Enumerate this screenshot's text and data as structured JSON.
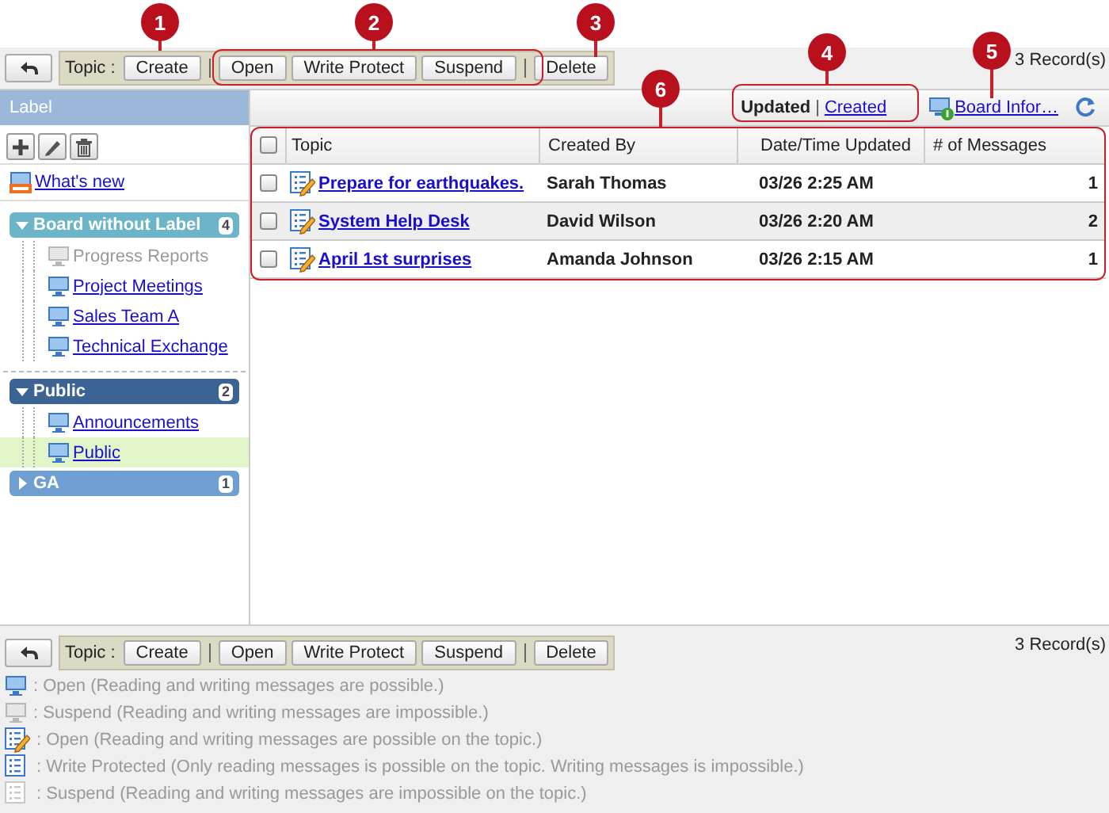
{
  "top_toolbar": {
    "topic_label": "Topic :",
    "button_groups": [
      [
        "Create"
      ],
      [
        "Open",
        "Write Protect",
        "Suspend"
      ],
      [
        "Delete"
      ]
    ],
    "record_count": "3 Record(s)"
  },
  "sidebar": {
    "title": "Label",
    "whats_new": "What's new",
    "labels": [
      {
        "name": "Board without Label",
        "count": "4",
        "expanded": true,
        "color": "#6cb4c8",
        "boards": [
          {
            "name": "Progress Reports",
            "suspended": true,
            "selected": false
          },
          {
            "name": "Project Meetings",
            "suspended": false,
            "selected": false
          },
          {
            "name": "Sales Team A",
            "suspended": false,
            "selected": false
          },
          {
            "name": "Technical Exchange",
            "suspended": false,
            "selected": false
          }
        ]
      },
      {
        "name": "Public",
        "count": "2",
        "expanded": true,
        "color": "#3b6494",
        "boards": [
          {
            "name": "Announcements",
            "suspended": false,
            "selected": false
          },
          {
            "name": "Public",
            "suspended": false,
            "selected": true
          }
        ]
      },
      {
        "name": "GA",
        "count": "1",
        "expanded": false,
        "color": "#6f9ed2"
      }
    ]
  },
  "sort": [
    {
      "label": "Updated",
      "selected": true
    },
    {
      "label": "Created",
      "selected": false
    }
  ],
  "sort_separator": "|",
  "board_info_link": "Board Infor…",
  "table": {
    "all_checked": false,
    "columns": [
      "Topic",
      "Created By",
      "Date/Time Updated",
      "# of Messages"
    ],
    "rows": [
      {
        "checked": false,
        "topic": "Prepare for earthquakes.",
        "created_by": "Sarah Thomas",
        "updated": "03/26 2:25 AM",
        "messages": "1"
      },
      {
        "checked": false,
        "topic": "System Help Desk",
        "created_by": "David Wilson",
        "updated": "03/26 2:20 AM",
        "messages": "2"
      },
      {
        "checked": false,
        "topic": "April 1st surprises",
        "created_by": "Amanda Johnson",
        "updated": "03/26 2:15 AM",
        "messages": "1"
      }
    ]
  },
  "bottom_toolbar": {
    "topic_label": "Topic :",
    "button_groups": [
      [
        "Create"
      ],
      [
        "Open",
        "Write Protect",
        "Suspend"
      ],
      [
        "Delete"
      ]
    ],
    "record_count": "3 Record(s)"
  },
  "legend": [
    {
      "kind": "board-open",
      "text": ": Open (Reading and writing messages are possible.)"
    },
    {
      "kind": "board-suspended",
      "text": ": Suspend (Reading and writing messages are impossible.)"
    },
    {
      "kind": "topic-open",
      "text": ": Open (Reading and writing messages are possible on the topic.)"
    },
    {
      "kind": "topic-protected",
      "text": ": Write Protected (Only reading messages is possible on the topic. Writing messages is impossible.)"
    },
    {
      "kind": "topic-suspended",
      "text": ": Suspend (Reading and writing messages are impossible on the topic.)"
    }
  ],
  "callouts": [
    {
      "number": "1"
    },
    {
      "number": "2"
    },
    {
      "number": "3"
    },
    {
      "number": "4"
    },
    {
      "number": "5"
    },
    {
      "number": "6"
    }
  ]
}
